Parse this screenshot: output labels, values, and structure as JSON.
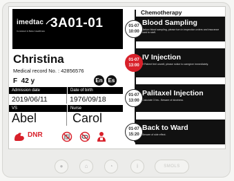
{
  "card": {
    "logo": "imedtac",
    "logo_sub": "Consistent & Better Healthcare",
    "room": "3A01-01",
    "name": "Christina",
    "mrn_label": "Medical record No. :",
    "mrn": "42856576",
    "sex": "F",
    "age": "42 y",
    "lang_badges": [
      "En",
      "Es"
    ],
    "admission_label": "Admission date",
    "admission_date": "2019/06/11",
    "dob_label": "Date of birth",
    "dob": "1976/09/18",
    "vs_label": "VS",
    "vs": "Abel",
    "nurse_label": "Nurse",
    "nurse": "Carol",
    "dnr": "DNR",
    "alert_icons": [
      "arm-muscle-icon",
      "no-food-icon",
      "no-pills-icon",
      "person-icon"
    ]
  },
  "timeline": {
    "title": "Chemotherapy",
    "events": [
      {
        "date": "01-07",
        "time": "10:00",
        "title": "Blood Sampling",
        "note": "Before blood sampling, please turn in inspection orders and insurance card to staff.",
        "active": false
      },
      {
        "date": "01-07",
        "time": "13:00",
        "title": "IV Injection",
        "note": "If Patient feel unwell, please notice to caregiver immediately.",
        "active": true
      },
      {
        "date": "01-07",
        "time": "13:00",
        "title": "Palitaxel Injection",
        "note": "Calculate 3 hrs - Beware of dizziness.",
        "active": false
      },
      {
        "date": "01-07",
        "time": "15:20",
        "title": "Back to Ward",
        "note": "Beware of side effect.",
        "active": false
      }
    ]
  },
  "controls": {
    "buttons": [
      "●",
      "⌂",
      "◔",
      "i"
    ],
    "pill": "SMOLS"
  },
  "colors": {
    "accent_red": "#d8202a",
    "dark": "#111111"
  }
}
